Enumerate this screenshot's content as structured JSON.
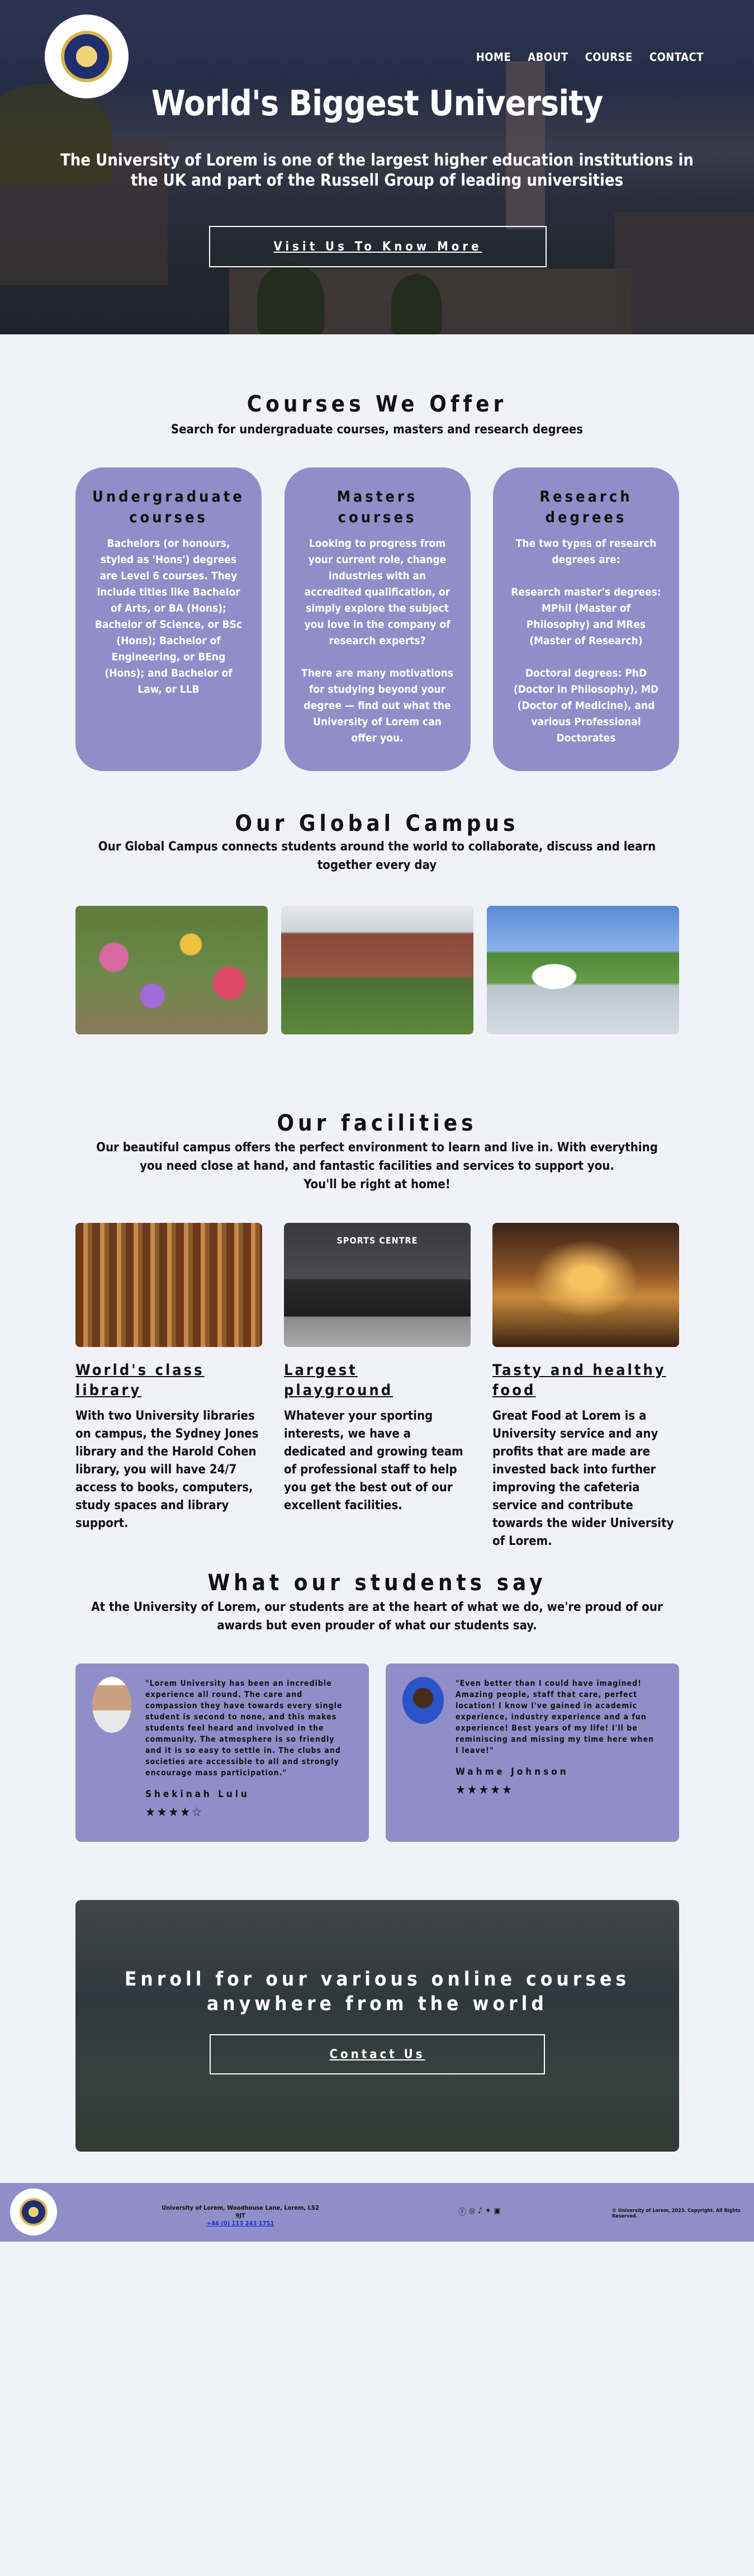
{
  "hero": {
    "nav": [
      "HOME",
      "ABOUT",
      "COURSE",
      "CONTACT"
    ],
    "title": "World's Biggest University",
    "subtitle": "The University of Lorem is one of the largest higher education institutions in the UK and part of the Russell Group of leading universities",
    "cta": "Visit Us To Know More"
  },
  "courses": {
    "title": "Courses We Offer",
    "subtitle": "Search for undergraduate courses, masters and research degrees",
    "cards": [
      {
        "title": "Undergraduate courses",
        "body": "Bachelors (or honours, styled as 'Hons') degrees are Level 6 courses. They include titles like Bachelor of Arts, or BA (Hons); Bachelor of Science, or BSc (Hons); Bachelor of Engineering, or BEng (Hons); and Bachelor of Law, or LLB"
      },
      {
        "title": "Masters courses",
        "body": "Looking to progress from your current role, change industries with an accredited qualification, or simply explore the subject you love in the company of research experts?\n\nThere are many motivations for studying beyond your degree — find out what the University of Lorem can offer you."
      },
      {
        "title": "Research degrees",
        "body": "The two types of research degrees are:\n\nResearch master's degrees: MPhil (Master of Philosophy) and MRes (Master of Research)\n\nDoctoral degrees: PhD (Doctor in Philosophy), MD (Doctor of Medicine), and various Professional Doctorates"
      }
    ]
  },
  "campus": {
    "title": "Our Global Campus",
    "subtitle": "Our Global Campus connects students around the world to collaborate, discuss and learn together every day"
  },
  "facilities": {
    "title": "Our facilities",
    "subtitle_1": "Our beautiful campus offers the perfect environment to learn and live in. With everything you need close at hand, and fantastic facilities and services to support you.",
    "subtitle_2": "You'll be right at home!",
    "sign_text": "SPORTS CENTRE",
    "cards": [
      {
        "title": "World's class library",
        "body": "With two University libraries on campus, the Sydney Jones library and the Harold Cohen library, you will have 24/7 access to books, computers, study spaces and library support."
      },
      {
        "title": "Largest playground",
        "body": "Whatever your sporting interests, we have a dedicated and growing team of professional staff to help you get the best out of our excellent facilities."
      },
      {
        "title": "Tasty and healthy food",
        "body": "Great Food at Lorem is a University service and any profits that are made are invested back into further improving the cafeteria service and contribute towards the wider University of Lorem."
      }
    ]
  },
  "testimonials": {
    "title": "What our students say",
    "subtitle": "At the University of Lorem, our students are at the heart of what we do, we're proud of our awards but even prouder of what our students say.",
    "items": [
      {
        "quote": "\"Lorem University has been an incredible experience all round. The care and compassion they have towards every single student is second to none, and this makes students feel heard and involved in the community. The atmosphere is so friendly and it is so easy to settle in. The clubs and societies are accessible to all and strongly encourage mass participation.\"",
        "name": "Shekinah Lulu",
        "stars": "★★★★☆"
      },
      {
        "quote": "\"Even better than I could have imagined! Amazing people, staff that care, perfect location! I know I've gained in academic experience, industry experience and a fun experience! Best years of my life! I'll be reminiscing and missing my time here when I leave!\"",
        "name": "Wahme Johnson",
        "stars": "★★★★★"
      }
    ]
  },
  "enroll": {
    "title_1": "Enroll for our various online courses",
    "title_2": "anywhere from the world",
    "cta": "Contact Us"
  },
  "footer": {
    "address": "University of Lorem, Woodhouse Lane, Lorem, LS2 9JT",
    "phone": "+44 (0) 113 243 1751",
    "copyright": "© University of Lorem, 2023. Copyright. All Rights Reserved."
  },
  "colors": {
    "card": "#8f8ec8",
    "background": "#f1f1f8"
  }
}
